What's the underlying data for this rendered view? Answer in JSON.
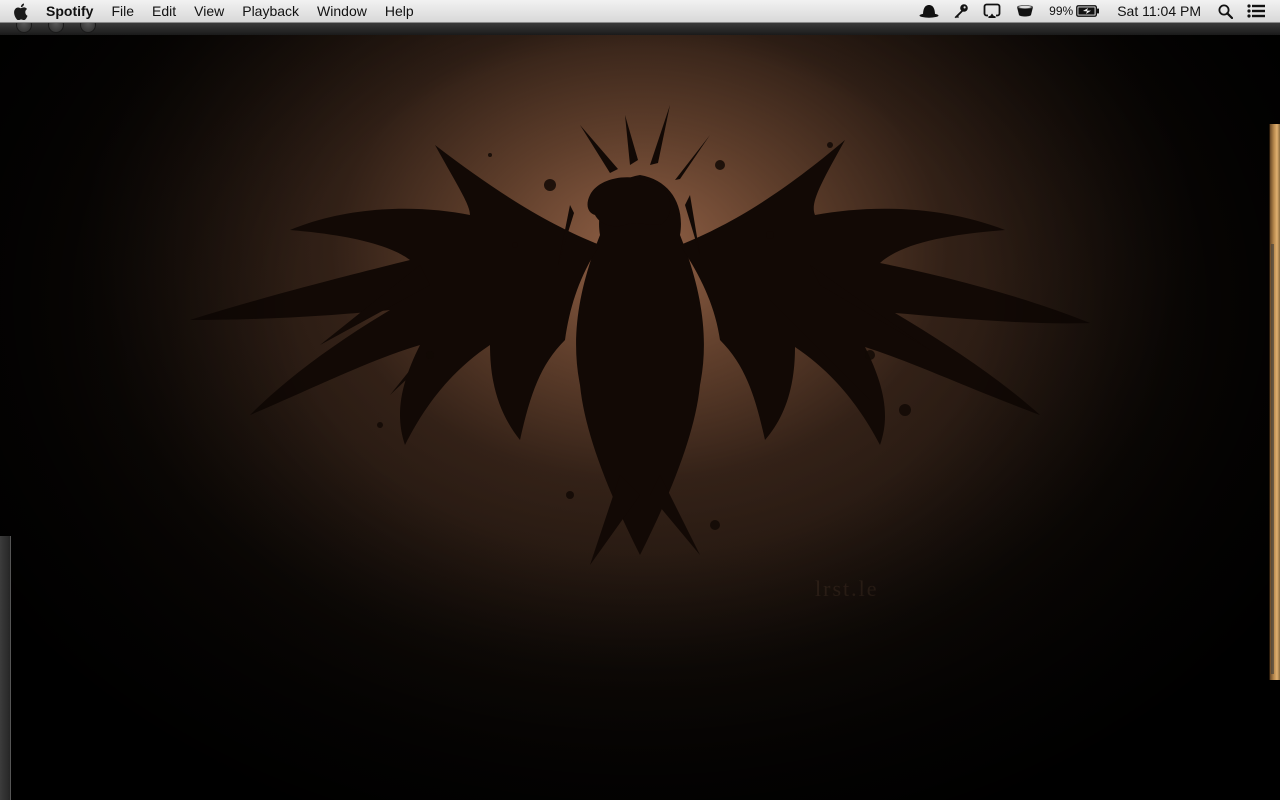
{
  "menubar": {
    "app_name": "Spotify",
    "menus": [
      "File",
      "Edit",
      "View",
      "Playback",
      "Window",
      "Help"
    ],
    "status": {
      "battery_percent": "99%",
      "clock": "Sat 11:04 PM"
    },
    "icons": [
      "apple-logo-icon",
      "bowler-hat-icon",
      "key-icon",
      "airplay-icon",
      "cup-icon",
      "battery-icon",
      "spotlight-search-icon",
      "notification-center-icon"
    ]
  },
  "desktop": {
    "wallpaper": "eagle",
    "watermark": "lrst.le"
  }
}
